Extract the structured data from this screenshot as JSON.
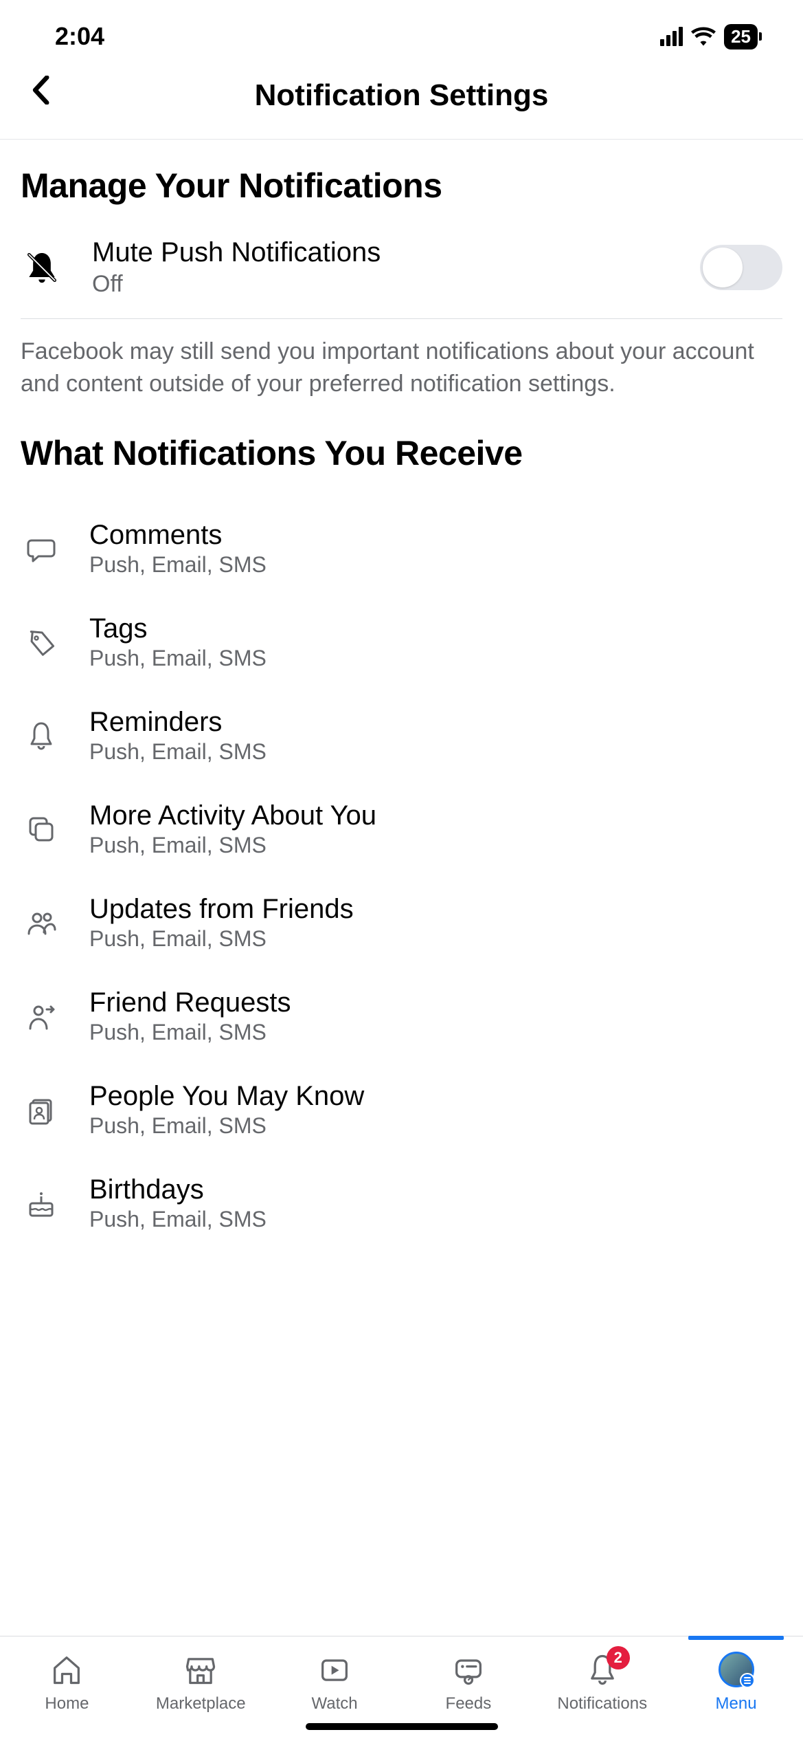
{
  "status": {
    "time": "2:04",
    "battery": "25"
  },
  "header": {
    "title": "Notification Settings"
  },
  "manage": {
    "heading": "Manage Your Notifications",
    "mute_title": "Mute Push Notifications",
    "mute_state": "Off",
    "note": "Facebook may still send you important notifications about your account and content outside of your preferred notification settings."
  },
  "receive": {
    "heading": "What Notifications You Receive",
    "items": [
      {
        "icon": "comment-icon",
        "title": "Comments",
        "sub": "Push, Email, SMS"
      },
      {
        "icon": "tag-icon",
        "title": "Tags",
        "sub": "Push, Email, SMS"
      },
      {
        "icon": "bell-icon",
        "title": "Reminders",
        "sub": "Push, Email, SMS"
      },
      {
        "icon": "stack-icon",
        "title": "More Activity About You",
        "sub": "Push, Email, SMS"
      },
      {
        "icon": "friends-icon",
        "title": "Updates from Friends",
        "sub": "Push, Email, SMS"
      },
      {
        "icon": "friend-request-icon",
        "title": "Friend Requests",
        "sub": "Push, Email, SMS"
      },
      {
        "icon": "people-icon",
        "title": "People You May Know",
        "sub": "Push, Email, SMS"
      },
      {
        "icon": "birthday-icon",
        "title": "Birthdays",
        "sub": "Push, Email, SMS"
      }
    ]
  },
  "tabs": {
    "items": [
      {
        "label": "Home"
      },
      {
        "label": "Marketplace"
      },
      {
        "label": "Watch"
      },
      {
        "label": "Feeds"
      },
      {
        "label": "Notifications",
        "badge": "2"
      },
      {
        "label": "Menu",
        "active": true
      }
    ]
  }
}
